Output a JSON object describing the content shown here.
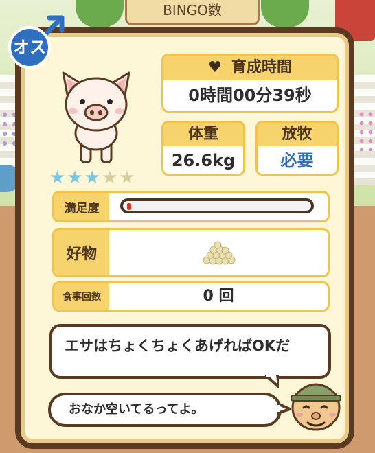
{
  "background": {
    "board_text": "BINGO数"
  },
  "gender": {
    "label": "オス",
    "icon": "male-symbol-icon"
  },
  "stars": {
    "filled": 3,
    "total": 5,
    "filled_color": "#7cc7e0",
    "empty_color": "#d9cda0"
  },
  "raise_time": {
    "label": "育成時間",
    "value": "0時間00分39秒"
  },
  "weight": {
    "label": "体重",
    "value": "26.6kg"
  },
  "pasture": {
    "label": "放牧",
    "value": "必要"
  },
  "satisfaction": {
    "label": "満足度",
    "fill_fraction": 0.02
  },
  "favorite": {
    "label": "好物",
    "icon": "grain-feed-icon"
  },
  "meals": {
    "label": "食事回数",
    "value": "0 回"
  },
  "dialog": {
    "line1": "エサはちょくちょくあげればOKだ",
    "line2": "おなか空いてるってよ。"
  },
  "colors": {
    "frame": "#5b3a22",
    "accent": "#f6d36c",
    "male_blue": "#2f6fc0",
    "pasture_text": "#2f6fc0"
  }
}
